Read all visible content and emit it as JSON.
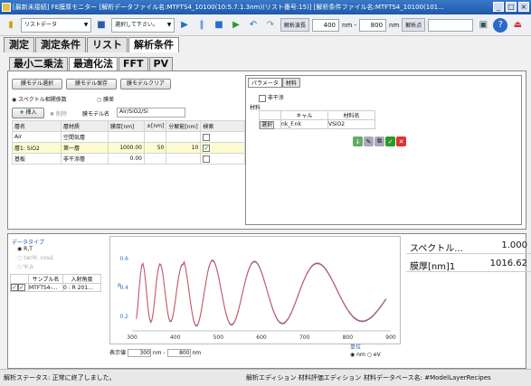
{
  "window": {
    "title": "[最新未接続] FE膜厚モニター [解析データファイル名:MTFTS4_10100(10:5.7.1.3nm)(リスト番号:15)] [解析条件ファイル名:MTFTS4_10100(101..."
  },
  "toolbar": {
    "list_data": "リストデータ",
    "select_placeholder": "選択して下さい。",
    "wavelength_label": "解析波長",
    "wl_min": "400",
    "wl_unit1": "nm -",
    "wl_max": "800",
    "wl_unit2": "nm",
    "analysis_point_label": "解析点"
  },
  "main_tabs": [
    "測定",
    "測定条件",
    "リスト",
    "解析条件"
  ],
  "sub_tabs": [
    "最小二乗法",
    "最適化法",
    "FFT",
    "PV"
  ],
  "buttons": {
    "model_select": "膜モデル選択",
    "model_save": "膜モデル保存",
    "model_clear": "膜モデルクリア",
    "insert": "挿入",
    "delete": "削除",
    "select": "選択"
  },
  "radio": {
    "spectrum": "スペクトル相関係数",
    "film": "膜差"
  },
  "model_name_label": "膜モデル名",
  "model_name_value": "Air/SiO2/Si",
  "grid": {
    "headers": [
      "層名",
      "層材质",
      "膜厚[nm]",
      "±[nm]",
      "分解能[nm]",
      "検索"
    ],
    "rows": [
      [
        "Air",
        "空間気層",
        "",
        "",
        "",
        false
      ],
      [
        "層1: SiO2",
        "第一層",
        "1000.00",
        "50",
        "10",
        true
      ],
      [
        "基板",
        "非干渉層",
        "0.00",
        "",
        "",
        false
      ]
    ]
  },
  "right": {
    "tabs": [
      "パラメータ",
      "材料"
    ],
    "noninterference": "非干渉",
    "material_label": "材料",
    "col1": "キャル",
    "col2": "材料名",
    "row_file": "nk_F.nk",
    "row_mat": "VSiO2"
  },
  "datatype": {
    "label": "データタイプ",
    "rt": "R,T",
    "tanpsi": "tanΨ, cosΔ",
    "psidelta": "Ψ,Δ"
  },
  "sample": {
    "col1": "サンプル名",
    "col2": "入射角度",
    "row_name": "MTFTS4-...",
    "row_angle": "0 : R  201..."
  },
  "chart_data": {
    "type": "line",
    "xlim": [
      300,
      900
    ],
    "ylim": [
      0.1,
      0.7
    ],
    "x_ticks": [
      "300",
      "400",
      "500",
      "600",
      "700",
      "800",
      "900"
    ],
    "y_ticks": [
      "0.6",
      "0.4",
      "0.2"
    ],
    "ylabel": "R",
    "series": [
      {
        "name": "",
        "color": "#3a6fbf"
      },
      {
        "name": "",
        "color": "#e05050"
      }
    ]
  },
  "display_range": {
    "label": "表示値",
    "min": "300",
    "sep": "nm -",
    "max": "800",
    "unit": "nm"
  },
  "unit_select": {
    "label": "単位",
    "nm": "nm",
    "ev": "eV"
  },
  "results": [
    {
      "label": "スペクトル...",
      "value": "1.000"
    },
    {
      "label": "膜厚[nm]1",
      "value": "1016.62"
    }
  ],
  "status": {
    "text": "解析ステータス: 正常に終了しました。",
    "mid": "解析エディション  材料評価エディション",
    "right": "材料データベース名: #ModelLayerRecipes"
  }
}
